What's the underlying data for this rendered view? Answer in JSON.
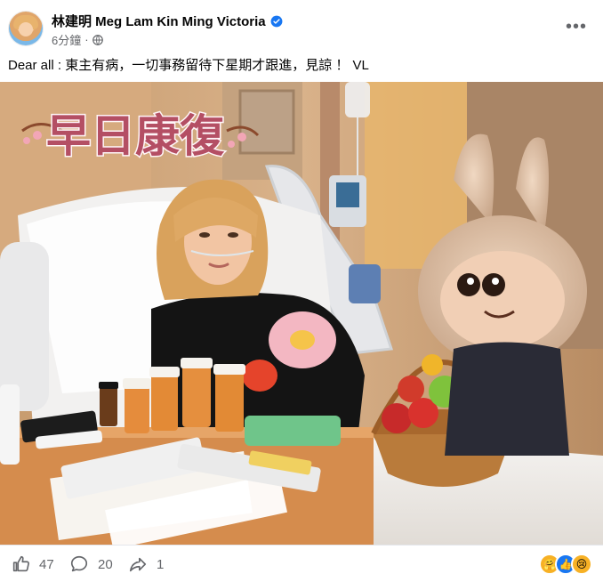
{
  "post": {
    "author": "林建明 Meg Lam Kin Ming Victoria",
    "time": "6分鐘",
    "separator": "·",
    "caption": "Dear all : 東主有病，一切事務留待下星期才跟進，見諒 ！ VL",
    "image": {
      "overlay_text": "早日康復"
    },
    "actions": {
      "likes": "47",
      "comments": "20",
      "shares": "1"
    },
    "reaction_icons": [
      "care-reaction",
      "like-reaction",
      "sad-reaction"
    ]
  },
  "colors": {
    "brand_blue": "#1877f2",
    "meta_grey": "#65676b",
    "text_dark": "#050505"
  }
}
